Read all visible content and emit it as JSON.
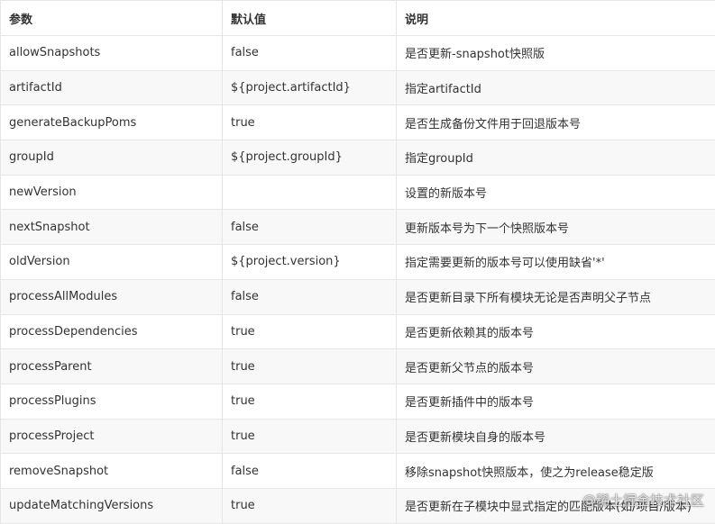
{
  "table": {
    "headers": [
      "参数",
      "默认值",
      "说明"
    ],
    "rows": [
      [
        "allowSnapshots",
        "false",
        "是否更新-snapshot快照版"
      ],
      [
        "artifactId",
        "${project.artifactId}",
        "指定artifactId"
      ],
      [
        "generateBackupPoms",
        "true",
        "是否生成备份文件用于回退版本号"
      ],
      [
        "groupId",
        "${project.groupId}",
        "指定groupId"
      ],
      [
        "newVersion",
        "",
        "设置的新版本号"
      ],
      [
        "nextSnapshot",
        "false",
        "更新版本号为下一个快照版本号"
      ],
      [
        "oldVersion",
        "${project.version}",
        "指定需要更新的版本号可以使用缺省'*'"
      ],
      [
        "processAllModules",
        "false",
        "是否更新目录下所有模块无论是否声明父子节点"
      ],
      [
        "processDependencies",
        "true",
        "是否更新依赖其的版本号"
      ],
      [
        "processParent",
        "true",
        "是否更新父节点的版本号"
      ],
      [
        "processPlugins",
        "true",
        "是否更新插件中的版本号"
      ],
      [
        "processProject",
        "true",
        "是否更新模块自身的版本号"
      ],
      [
        "removeSnapshot",
        "false",
        "移除snapshot快照版本，使之为release稳定版"
      ],
      [
        "updateMatchingVersions",
        "true",
        "是否更新在子模块中显式指定的匹配版本(如/项目/版本)"
      ]
    ]
  },
  "watermark": "@稀土掘金技术社区"
}
